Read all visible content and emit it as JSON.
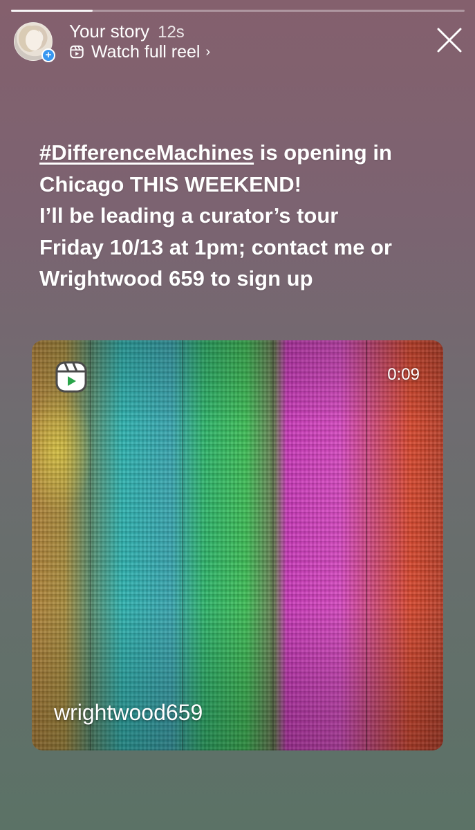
{
  "story": {
    "progress": 0.18
  },
  "header": {
    "title": "Your story",
    "time": "12s",
    "reel_link": "Watch full reel",
    "reel_chevron": "›",
    "add_badge": "+"
  },
  "caption": {
    "hashtag": "#DifferenceMachines",
    "line1_rest": " is opening in",
    "line2": "Chicago THIS WEEKEND!",
    "line3": "I’ll be leading a curator’s tour",
    "line4": "Friday 10/13 at 1pm; contact me or",
    "line5": "Wrightwood 659 to sign up"
  },
  "reel_card": {
    "duration": "0:09",
    "username": "wrightwood659",
    "icon": "reels-icon"
  },
  "icons": {
    "close": "close-icon",
    "reel_link_icon": "reels-icon",
    "chevron": "chevron-right-icon"
  }
}
